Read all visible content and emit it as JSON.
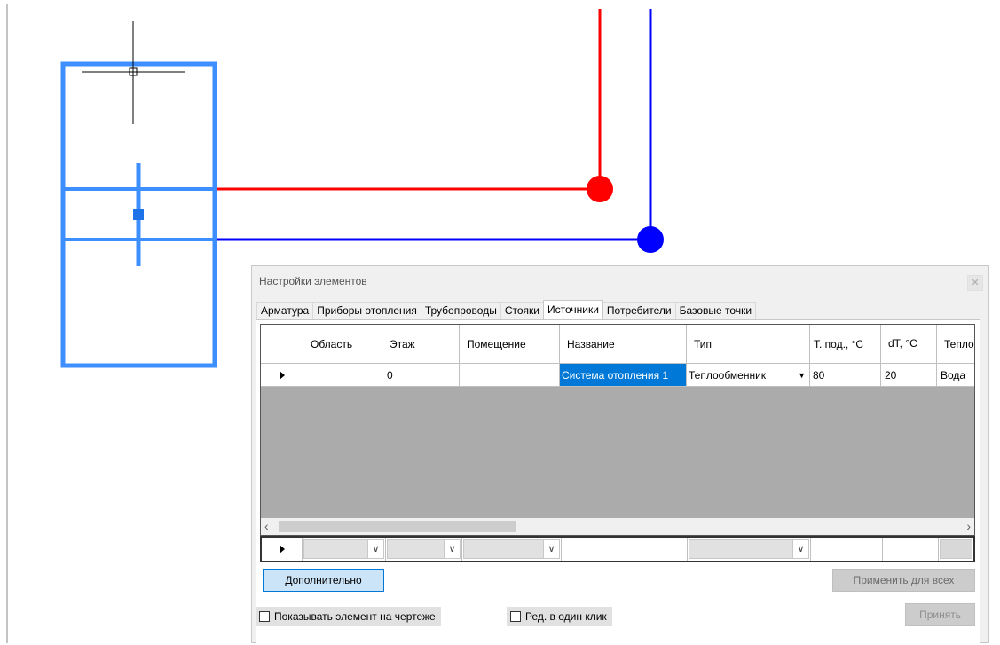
{
  "colors": {
    "supply_pipe": "#ff0000",
    "return_pipe": "#0000ff",
    "selection": "#3d8fff",
    "selected_cell": "#0078d7"
  },
  "dialog": {
    "title": "Настройки элементов",
    "close_icon": "close-icon",
    "tabs": [
      "Арматура",
      "Приборы отопления",
      "Трубопроводы",
      "Стояки",
      "Источники",
      "Потребители",
      "Базовые точки"
    ],
    "active_tab": "Источники",
    "grid": {
      "columns": [
        "Область",
        "Этаж",
        "Помещение",
        "Название",
        "Тип",
        "Т. под., °C",
        "dT, °C",
        "Тепло"
      ],
      "rows": [
        {
          "area": "",
          "floor": "0",
          "room": "",
          "name": "Система отопления 1",
          "type": "Теплообменник",
          "t_supply": "80",
          "dt": "20",
          "carrier": "Вода"
        }
      ]
    },
    "buttons": {
      "more": "Дополнительно",
      "apply_all": "Применить для всех",
      "accept": "Принять"
    },
    "checkboxes": {
      "show_on_drawing": "Показывать элемент на чертеже",
      "one_click_edit": "Ред. в один клик"
    }
  }
}
